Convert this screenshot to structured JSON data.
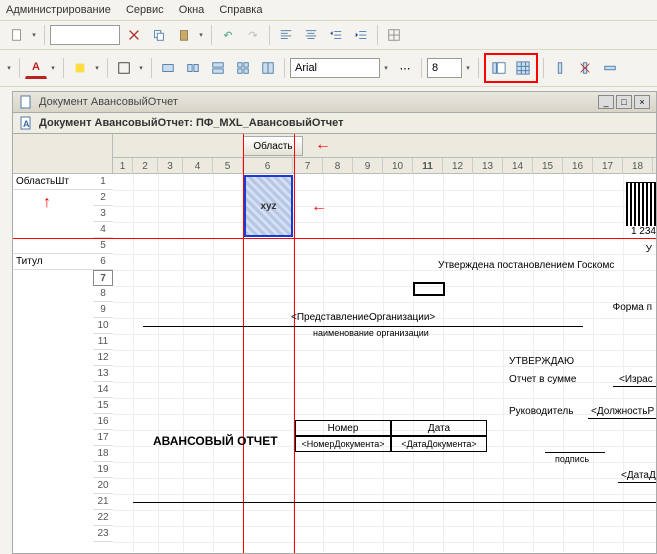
{
  "menu": {
    "admin": "Администрирование",
    "service": "Сервис",
    "windows": "Окна",
    "help": "Справка"
  },
  "toolbar2": {
    "font": "Arial",
    "size": "8"
  },
  "window": {
    "title": "Документ АвансовыйОтчет",
    "doc_title": "Документ АвансовыйОтчет: ПФ_MXL_АвансовыйОтчет"
  },
  "sheet": {
    "area_btn": "Область",
    "area_label_sh": "ОбластьШт",
    "area_label_title": "Титул",
    "xyz": "xyz",
    "cols": [
      "1",
      "2",
      "3",
      "4",
      "5",
      "6",
      "7",
      "8",
      "9",
      "10",
      "11",
      "12",
      "13",
      "14",
      "15",
      "16",
      "17",
      "18"
    ],
    "rows": [
      "1",
      "2",
      "3",
      "4",
      "5",
      "6",
      "7",
      "8",
      "9",
      "10",
      "11",
      "12",
      "13",
      "14",
      "15",
      "16",
      "17",
      "18",
      "19",
      "20",
      "21",
      "22",
      "23"
    ]
  },
  "form": {
    "barcode_num": "1 234",
    "u_letter": "У",
    "approved_by": "Утверждена постановлением Госкомс",
    "forma": "Форма п",
    "org_placeholder": "<ПредставлениеОрганизации>",
    "org_caption": "наименование организации",
    "utverzhdayu": "УТВЕРЖДАЮ",
    "otchet_v_summe": "Отчет в сумме",
    "izras": "<Израс",
    "rukovoditel": "Руководитель",
    "dolzhnost": "<ДолжностьР",
    "nomer": "Номер",
    "data": "Дата",
    "nomer_doc": "<НомерДокумента>",
    "data_doc": "<ДатаДокумента>",
    "avans_title": "АВАНСОВЫЙ ОТЧЕТ",
    "podpis": "подпись",
    "data_d": "<ДатаД"
  }
}
